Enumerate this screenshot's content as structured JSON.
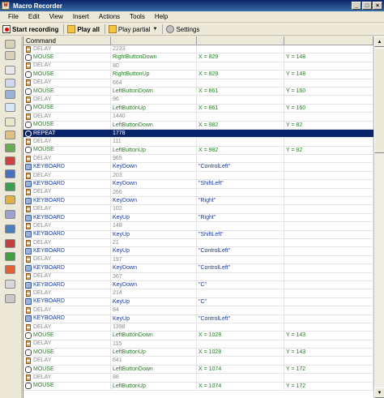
{
  "window": {
    "title": "Macro Recorder"
  },
  "menu": [
    "File",
    "Edit",
    "View",
    "Insert",
    "Actions",
    "Tools",
    "Help"
  ],
  "toolbar": {
    "start_recording": "Start recording",
    "play_all": "Play all",
    "play_partial": "Play partial",
    "settings": "Settings"
  },
  "grid": {
    "columns": [
      "Command",
      "",
      "",
      ""
    ],
    "rows": [
      {
        "type": "delay",
        "command": "DELAY",
        "p1": "2233",
        "p2": "",
        "p3": ""
      },
      {
        "type": "mouse",
        "command": "MOUSE",
        "p1": "RightButtonDown",
        "p2": "X = 829",
        "p3": "Y = 148"
      },
      {
        "type": "delay",
        "command": "DELAY",
        "p1": "80",
        "p2": "",
        "p3": ""
      },
      {
        "type": "mouse",
        "command": "MOUSE",
        "p1": "RightButtonUp",
        "p2": "X = 829",
        "p3": "Y = 148"
      },
      {
        "type": "delay",
        "command": "DELAY",
        "p1": "664",
        "p2": "",
        "p3": ""
      },
      {
        "type": "mouse",
        "command": "MOUSE",
        "p1": "LeftButtonDown",
        "p2": "X = 861",
        "p3": "Y = 160"
      },
      {
        "type": "delay",
        "command": "DELAY",
        "p1": "96",
        "p2": "",
        "p3": ""
      },
      {
        "type": "mouse",
        "command": "MOUSE",
        "p1": "LeftButtonUp",
        "p2": "X = 861",
        "p3": "Y = 160"
      },
      {
        "type": "delay",
        "command": "DELAY",
        "p1": "1440",
        "p2": "",
        "p3": ""
      },
      {
        "type": "mouse",
        "command": "MOUSE",
        "p1": "LeftButtonDown",
        "p2": "X = 982",
        "p3": "Y = 82"
      },
      {
        "type": "repeat",
        "command": "REPEAT",
        "p1": "1778",
        "p2": "",
        "p3": "",
        "selected": true
      },
      {
        "type": "delay",
        "command": "DELAY",
        "p1": "111",
        "p2": "",
        "p3": ""
      },
      {
        "type": "mouse",
        "command": "MOUSE",
        "p1": "LeftButtonUp",
        "p2": "X = 982",
        "p3": "Y = 82"
      },
      {
        "type": "delay",
        "command": "DELAY",
        "p1": "965",
        "p2": "",
        "p3": ""
      },
      {
        "type": "kbd",
        "command": "KEYBOARD",
        "p1": "KeyDown",
        "p2": "\"ControlLeft\"",
        "p3": ""
      },
      {
        "type": "delay",
        "command": "DELAY",
        "p1": "203",
        "p2": "",
        "p3": ""
      },
      {
        "type": "kbd",
        "command": "KEYBOARD",
        "p1": "KeyDown",
        "p2": "\"ShiftLeft\"",
        "p3": ""
      },
      {
        "type": "delay",
        "command": "DELAY",
        "p1": "266",
        "p2": "",
        "p3": ""
      },
      {
        "type": "kbd",
        "command": "KEYBOARD",
        "p1": "KeyDown",
        "p2": "\"Right\"",
        "p3": ""
      },
      {
        "type": "delay",
        "command": "DELAY",
        "p1": "102",
        "p2": "",
        "p3": ""
      },
      {
        "type": "kbd",
        "command": "KEYBOARD",
        "p1": "KeyUp",
        "p2": "\"Right\"",
        "p3": ""
      },
      {
        "type": "delay",
        "command": "DELAY",
        "p1": "148",
        "p2": "",
        "p3": ""
      },
      {
        "type": "kbd",
        "command": "KEYBOARD",
        "p1": "KeyUp",
        "p2": "\"ShiftLeft\"",
        "p3": ""
      },
      {
        "type": "delay",
        "command": "DELAY",
        "p1": "21",
        "p2": "",
        "p3": ""
      },
      {
        "type": "kbd",
        "command": "KEYBOARD",
        "p1": "KeyUp",
        "p2": "\"ControlLeft\"",
        "p3": ""
      },
      {
        "type": "delay",
        "command": "DELAY",
        "p1": "197",
        "p2": "",
        "p3": ""
      },
      {
        "type": "kbd",
        "command": "KEYBOARD",
        "p1": "KeyDown",
        "p2": "\"ControlLeft\"",
        "p3": ""
      },
      {
        "type": "delay",
        "command": "DELAY",
        "p1": "367",
        "p2": "",
        "p3": ""
      },
      {
        "type": "kbd",
        "command": "KEYBOARD",
        "p1": "KeyDown",
        "p2": "\"C\"",
        "p3": ""
      },
      {
        "type": "delay",
        "command": "DELAY",
        "p1": "214",
        "p2": "",
        "p3": ""
      },
      {
        "type": "kbd",
        "command": "KEYBOARD",
        "p1": "KeyUp",
        "p2": "\"C\"",
        "p3": ""
      },
      {
        "type": "delay",
        "command": "DELAY",
        "p1": "84",
        "p2": "",
        "p3": ""
      },
      {
        "type": "kbd",
        "command": "KEYBOARD",
        "p1": "KeyUp",
        "p2": "\"ControlLeft\"",
        "p3": ""
      },
      {
        "type": "delay",
        "command": "DELAY",
        "p1": "1398",
        "p2": "",
        "p3": ""
      },
      {
        "type": "mouse",
        "command": "MOUSE",
        "p1": "LeftButtonDown",
        "p2": "X = 1028",
        "p3": "Y = 143"
      },
      {
        "type": "delay",
        "command": "DELAY",
        "p1": "115",
        "p2": "",
        "p3": ""
      },
      {
        "type": "mouse",
        "command": "MOUSE",
        "p1": "LeftButtonUp",
        "p2": "X = 1028",
        "p3": "Y = 143"
      },
      {
        "type": "delay",
        "command": "DELAY",
        "p1": "641",
        "p2": "",
        "p3": ""
      },
      {
        "type": "mouse",
        "command": "MOUSE",
        "p1": "LeftButtonDown",
        "p2": "X = 1074",
        "p3": "Y = 172"
      },
      {
        "type": "delay",
        "command": "DELAY",
        "p1": "88",
        "p2": "",
        "p3": ""
      },
      {
        "type": "mouse",
        "command": "MOUSE",
        "p1": "LeftButtonUp",
        "p2": "X = 1074",
        "p3": "Y = 172"
      }
    ]
  },
  "sidebar_icons": [
    "undo-icon",
    "redo-icon",
    "mouse-tool-icon",
    "keyboard-tool-icon",
    "window-tool-icon",
    "image-tool-icon",
    "text-tool-icon",
    "delay-tool-icon",
    "color-picker-icon",
    "stop-icon",
    "info-icon",
    "web-icon",
    "file-icon",
    "variable-icon",
    "repeat-tool-icon",
    "text-insert-icon",
    "play-icon",
    "record-icon",
    "message-icon",
    "note-icon"
  ]
}
